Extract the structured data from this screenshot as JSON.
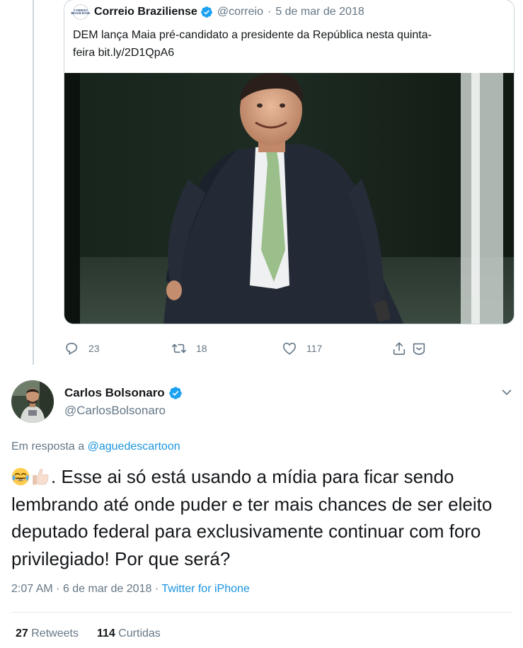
{
  "quoted_tweet": {
    "avatar_text": [
      "CORREIO",
      "BRAZILIENSE"
    ],
    "author_name": "Correio Braziliense",
    "handle": "@correio",
    "separator": "·",
    "date": "5 de mar de 2018",
    "text_line1": "DEM lança Maia pré-candidato a presidente da República nesta quinta-",
    "text_line2": "feira bit.ly/2D1QpA6",
    "image_alt": "Photo of a man in a dark suit walking"
  },
  "actions": {
    "replies": "23",
    "retweets": "18",
    "likes": "117"
  },
  "tweet": {
    "author_name": "Carlos Bolsonaro",
    "handle": "@CarlosBolsonaro",
    "reply_prefix": "Em resposta a",
    "reply_to": "@aguedescartoon",
    "text": ". Esse ai só está usando a mídia para ficar sendo lembrando até onde puder e ter mais chances de ser eleito deputado federal para exclusivamente continuar com foro privilegiado! Por que será?",
    "emojis": [
      "face-with-tears-of-joy-icon",
      "thumbs-up-icon"
    ],
    "time": "2:07 AM",
    "separator": "·",
    "date": "6 de mar de 2018",
    "source": "Twitter for iPhone"
  },
  "stats": {
    "retweets_count": "27",
    "retweets_label": "Retweets",
    "likes_count": "114",
    "likes_label": "Curtidas"
  },
  "colors": {
    "link": "#1b95e0",
    "verified": "#1da1f2",
    "muted": "#657786",
    "border": "#ccd6dd"
  }
}
